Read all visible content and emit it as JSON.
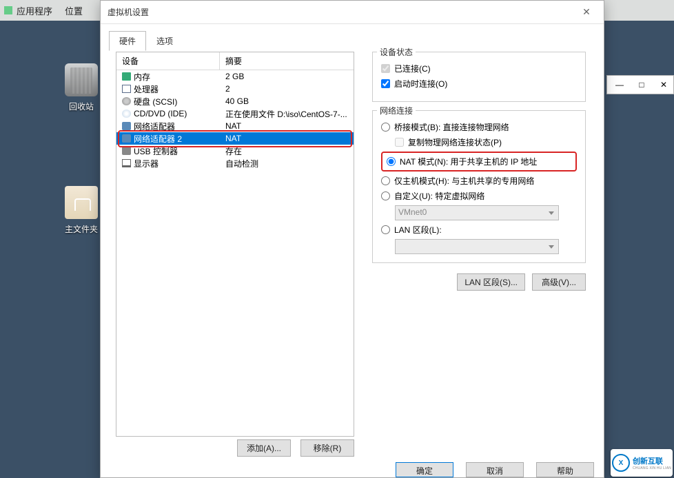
{
  "topmenu": {
    "apps": "应用程序",
    "places": "位置"
  },
  "desktop": {
    "trash": "回收站",
    "home": "主文件夹"
  },
  "rightwin": {
    "min": "—",
    "max": "□",
    "close": "✕"
  },
  "dialog": {
    "title": "虚拟机设置",
    "close": "✕",
    "tabs": {
      "hardware": "硬件",
      "options": "选项"
    },
    "headers": {
      "device": "设备",
      "summary": "摘要"
    },
    "devices": [
      {
        "name": "内存",
        "summary": "2 GB",
        "icon": "ico-mem"
      },
      {
        "name": "处理器",
        "summary": "2",
        "icon": "ico-cpu"
      },
      {
        "name": "硬盘 (SCSI)",
        "summary": "40 GB",
        "icon": "ico-disk"
      },
      {
        "name": "CD/DVD (IDE)",
        "summary": "正在使用文件 D:\\iso\\CentOS-7-...",
        "icon": "ico-cd"
      },
      {
        "name": "网络适配器",
        "summary": "NAT",
        "icon": "ico-net"
      },
      {
        "name": "网络适配器 2",
        "summary": "NAT",
        "icon": "ico-net",
        "selected": true
      },
      {
        "name": "USB 控制器",
        "summary": "存在",
        "icon": "ico-usb"
      },
      {
        "name": "显示器",
        "summary": "自动检测",
        "icon": "ico-disp"
      }
    ],
    "status": {
      "legend": "设备状态",
      "connected": "已连接(C)",
      "connectOnStart": "启动时连接(O)"
    },
    "net": {
      "legend": "网络连接",
      "bridge": "桥接模式(B): 直接连接物理网络",
      "replicate": "复制物理网络连接状态(P)",
      "nat": "NAT 模式(N): 用于共享主机的 IP 地址",
      "hostonly": "仅主机模式(H): 与主机共享的专用网络",
      "custom": "自定义(U): 特定虚拟网络",
      "vmnet": "VMnet0",
      "lanseg": "LAN 区段(L):"
    },
    "buttons": {
      "lanSegments": "LAN 区段(S)...",
      "advanced": "高级(V)...",
      "add": "添加(A)...",
      "remove": "移除(R)",
      "ok": "确定",
      "cancel": "取消",
      "help": "帮助"
    }
  },
  "watermark": {
    "brand": "创新互联",
    "sub": "CHUANG XIN HU LIAN",
    "mark": "X"
  }
}
